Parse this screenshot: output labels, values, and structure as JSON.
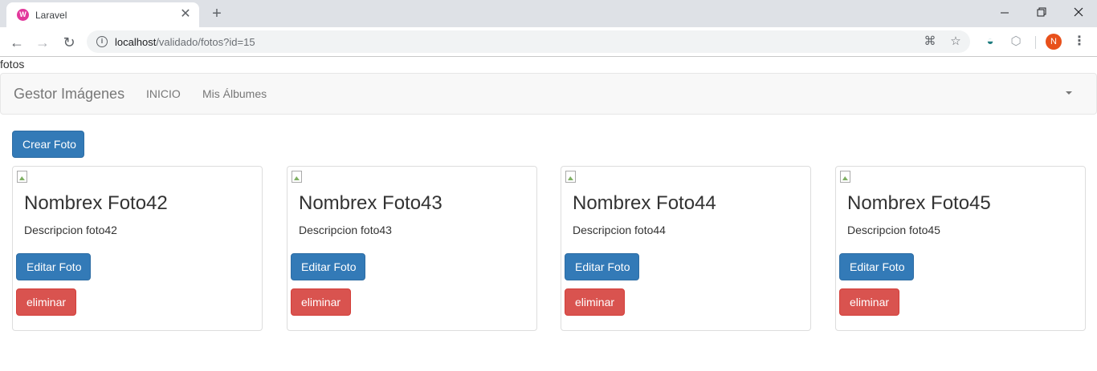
{
  "browser": {
    "tab_title": "Laravel",
    "url_host": "localhost",
    "url_path": "/validado/fotos?id=15",
    "profile_initial": "N",
    "colors": {
      "tab_favicon": "#e2389b",
      "avatar": "#e8501b"
    }
  },
  "page": {
    "label": "fotos"
  },
  "navbar": {
    "brand": "Gestor Imágenes",
    "links": [
      "INICIO",
      "Mis Álbumes"
    ]
  },
  "actions": {
    "create_label": "Crear Foto"
  },
  "cards": [
    {
      "title": "Nombrex Foto42",
      "description": "Descripcion foto42",
      "edit_label": "Editar Foto",
      "delete_label": "eliminar"
    },
    {
      "title": "Nombrex Foto43",
      "description": "Descripcion foto43",
      "edit_label": "Editar Foto",
      "delete_label": "eliminar"
    },
    {
      "title": "Nombrex Foto44",
      "description": "Descripcion foto44",
      "edit_label": "Editar Foto",
      "delete_label": "eliminar"
    },
    {
      "title": "Nombrex Foto45",
      "description": "Descripcion foto45",
      "edit_label": "Editar Foto",
      "delete_label": "eliminar"
    }
  ],
  "theme": {
    "primary": "#337ab7",
    "danger": "#d9534f",
    "navbar_bg": "#f8f8f8"
  }
}
